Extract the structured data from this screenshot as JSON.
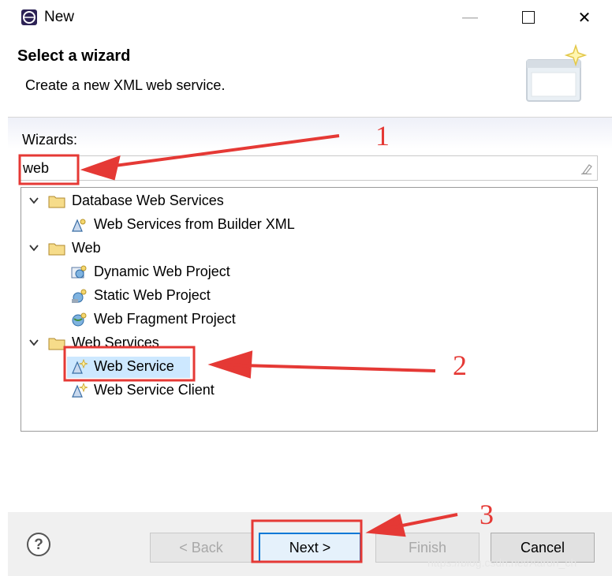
{
  "window": {
    "title": "New",
    "controls": {
      "minimize": "—",
      "maximize": "",
      "close": "✕"
    }
  },
  "header": {
    "title": "Select a wizard",
    "description": "Create a new XML web service."
  },
  "wizards": {
    "label": "Wizards:",
    "filter_value": "web"
  },
  "tree": [
    {
      "label": "Database Web Services",
      "type": "category",
      "expanded": true,
      "icon": "folder-icon"
    },
    {
      "label": "Web Services from Builder XML",
      "type": "item",
      "icon": "web-service-builder-icon"
    },
    {
      "label": "Web",
      "type": "category",
      "expanded": true,
      "icon": "folder-icon"
    },
    {
      "label": "Dynamic Web Project",
      "type": "item",
      "icon": "dynamic-web-project-icon"
    },
    {
      "label": "Static Web Project",
      "type": "item",
      "icon": "static-web-project-icon"
    },
    {
      "label": "Web Fragment Project",
      "type": "item",
      "icon": "web-fragment-project-icon"
    },
    {
      "label": "Web Services",
      "type": "category",
      "expanded": true,
      "icon": "folder-icon"
    },
    {
      "label": "Web Service",
      "type": "item",
      "icon": "web-service-icon",
      "selected": true
    },
    {
      "label": "Web Service Client",
      "type": "item",
      "icon": "web-service-client-icon"
    }
  ],
  "buttons": {
    "help": "?",
    "back": "< Back",
    "next": "Next >",
    "finish": "Finish",
    "cancel": "Cancel"
  },
  "annotations": {
    "step1": "1",
    "step2": "2",
    "step3": "3",
    "color": "#e53935"
  },
  "watermark": "https://blog.csdn.net/Aaron_ch"
}
